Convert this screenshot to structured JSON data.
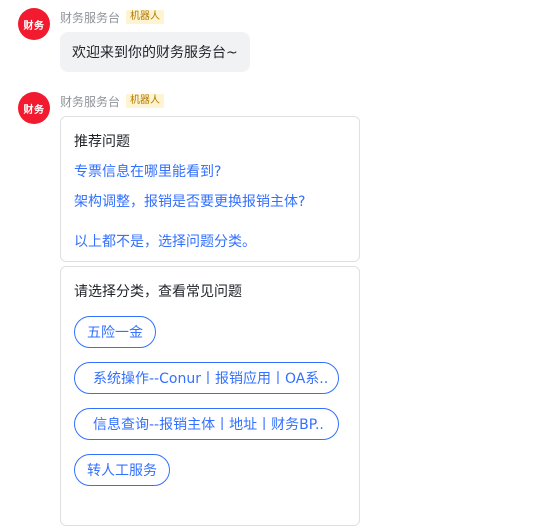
{
  "message1": {
    "avatar_text": "财务",
    "sender": "财务服务台",
    "badge": "机器人",
    "text": "欢迎来到你的财务服务台~"
  },
  "message2": {
    "avatar_text": "财务",
    "sender": "财务服务台",
    "badge": "机器人",
    "recommend_card": {
      "title": "推荐问题",
      "questions": [
        "专票信息在哪里能看到?",
        "架构调整，报销是否要更换报销主体?"
      ],
      "fallback": "以上都不是，选择问题分类。"
    },
    "category_card": {
      "title": "请选择分类，查看常见问题",
      "options": [
        "五险一金",
        "系统操作--Conur丨报销应用丨OA系..",
        "信息查询--报销主体丨地址丨财务BP..",
        "转人工服务"
      ]
    }
  },
  "colors": {
    "avatar_bg": "#f21a2e",
    "link": "#3370ff",
    "badge_bg": "#fff4d1",
    "badge_text": "#b07a00",
    "bubble_bg": "#f1f2f4"
  }
}
